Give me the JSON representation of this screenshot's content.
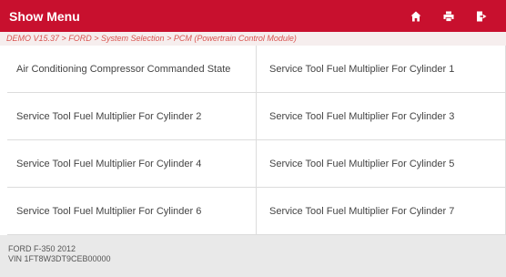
{
  "header": {
    "title": "Show Menu",
    "icons": [
      "home-icon",
      "print-icon",
      "exit-icon"
    ],
    "background_color": "#c8102e"
  },
  "breadcrumb": "DEMO V15.37 > FORD > System Selection > PCM (Powertrain Control Module)",
  "items": [
    "Air Conditioning Compressor Commanded State",
    "Service Tool Fuel Multiplier For Cylinder 1",
    "Service Tool Fuel Multiplier For Cylinder 2",
    "Service Tool Fuel Multiplier For Cylinder 3",
    "Service Tool Fuel Multiplier For Cylinder 4",
    "Service Tool Fuel Multiplier For Cylinder 5",
    "Service Tool Fuel Multiplier For Cylinder 6",
    "Service Tool Fuel Multiplier For Cylinder 7"
  ],
  "footer": {
    "vehicle": "FORD F-350 2012",
    "vin": "VIN 1FT8W3DT9CEB00000"
  }
}
